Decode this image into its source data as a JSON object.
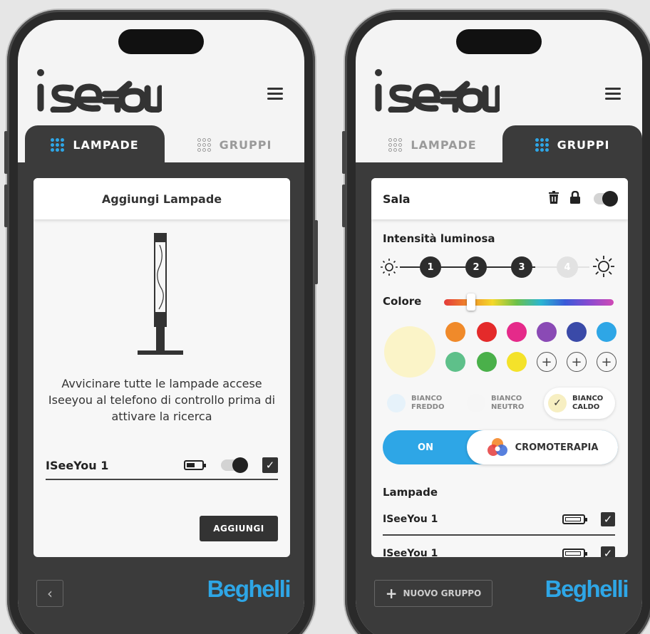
{
  "brand": {
    "logo_text": "iseeYou",
    "company": "Beghelli",
    "company_color": "#2ea6e6",
    "accent": "#2ea6e6"
  },
  "left": {
    "tabs": [
      {
        "label": "LAMPADE",
        "active": true
      },
      {
        "label": "GRUPPI",
        "active": false
      }
    ],
    "card_title": "Aggiungi Lampade",
    "instruction": "Avvicinare tutte le lampade accese Iseeyou al telefono di controllo prima di attivare la ricerca",
    "lamp": {
      "name": "ISeeYou 1",
      "toggle_on": true,
      "checked": true
    },
    "add_button": "AGGIUNGI",
    "back_icon": "chevron-left-icon"
  },
  "right": {
    "tabs": [
      {
        "label": "LAMPADE",
        "active": false
      },
      {
        "label": "GRUPPI",
        "active": true
      }
    ],
    "group_name": "Sala",
    "group_toggle_on": true,
    "intensity_label": "Intensità luminosa",
    "intensity_steps": [
      "1",
      "2",
      "3",
      "4"
    ],
    "intensity_level": 3,
    "color_label": "Colore",
    "selected_color": "#fbf4c8",
    "swatches": [
      "#f08a2a",
      "#e42a2a",
      "#e52a8a",
      "#8a4ab5",
      "#3a4aa8",
      "#2ea6e6",
      "#5ec08a",
      "#4ab04a",
      "#f4e22a"
    ],
    "whites": [
      {
        "line1": "BIANCO",
        "line2": "FREDDO",
        "color": "#e6f2fa",
        "selected": false
      },
      {
        "line1": "BIANCO",
        "line2": "NEUTRO",
        "color": "#f6f6f6",
        "selected": false
      },
      {
        "line1": "BIANCO",
        "line2": "CALDO",
        "color": "#f7efc2",
        "selected": true
      }
    ],
    "mode_on": "ON",
    "mode_crom": "CROMOTERAPIA",
    "lamps_label": "Lampade",
    "lamps": [
      {
        "name": "ISeeYou 1"
      },
      {
        "name": "ISeeYou 1"
      }
    ],
    "new_group": "NUOVO GRUPPO"
  }
}
